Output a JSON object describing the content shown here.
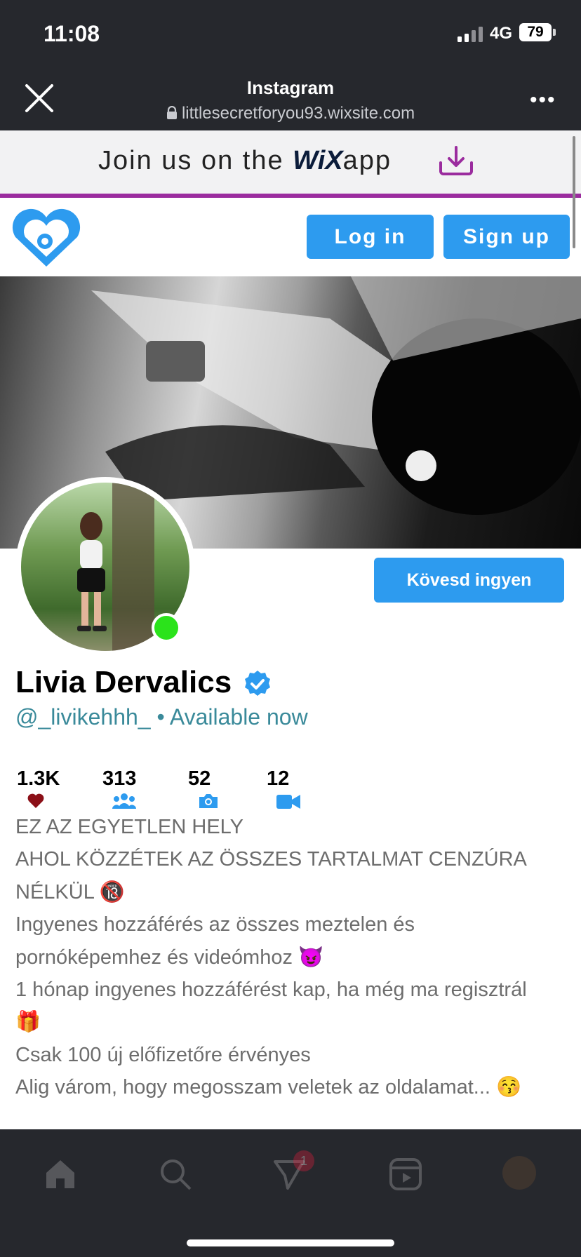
{
  "status_bar": {
    "time": "11:08",
    "network": "4G",
    "battery": "79"
  },
  "browser": {
    "title": "Instagram",
    "url": "littlesecretforyou93.wixsite.com",
    "more_label": "•••"
  },
  "wix_banner": {
    "text_prefix": "Join us on the ",
    "brand": "WiX",
    "text_suffix": "app"
  },
  "header": {
    "login_label": "Log in",
    "signup_label": "Sign up"
  },
  "profile": {
    "name": "Livia Dervalics",
    "handle": "@_livikehhh_",
    "availability": " • Available now",
    "follow_label": "Kövesd ingyen",
    "stats": [
      {
        "value": "1.3K",
        "icon": "heart-icon"
      },
      {
        "value": "313",
        "icon": "users-icon"
      },
      {
        "value": "52",
        "icon": "camera-icon"
      },
      {
        "value": "12",
        "icon": "video-icon"
      }
    ],
    "bio_lines": [
      "EZ AZ EGYETLEN HELY",
      "AHOL KÖZZÉTEK AZ ÖSSZES TARTALMAT CENZÚRA",
      "NÉLKÜL 🔞",
      "Ingyenes hozzáférés az összes meztelen és",
      "pornóképemhez és videómhoz 😈",
      "1 hónap ingyenes hozzáférést kap, ha még ma regisztrál",
      "🎁",
      "Csak 100 új előfizetőre érvényes",
      "Alig várom, hogy megosszam veletek az oldalamat... 😚"
    ]
  },
  "bottom_nav": {
    "badge": "1"
  },
  "colors": {
    "accent": "#2d9bef",
    "wix_purple": "#9b2c9e",
    "online": "#2be31b",
    "handle": "#3a8a9a",
    "heart": "#8b0f17"
  }
}
